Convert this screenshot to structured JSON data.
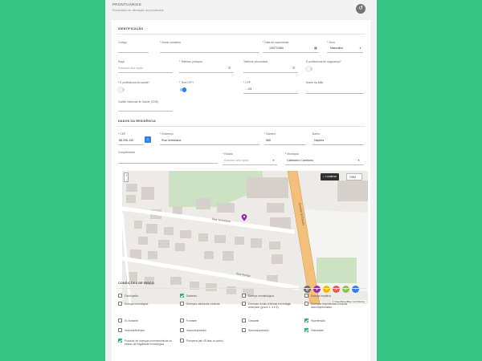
{
  "header": {
    "title": "PRONTUÁRIOS",
    "subtitle": "Formulário de alteração do prontuário"
  },
  "identificacao": {
    "section_title": "IDENTIFICAÇÃO",
    "codigo_label": "Código",
    "nome_completo_label": "* Nome completo",
    "data_nascimento_label": "* Data de nascimento",
    "data_nascimento_value": "14/07/1960",
    "sexo_label": "* Sexo",
    "sexo_value": "Masculino",
    "raca_label": "Raça",
    "raca_placeholder": "Selecione uma opção",
    "telefone_principal_label": "* Telefone principal",
    "telefone_secundario_label": "Telefone secundário",
    "profissional_seguranca_label": "É profissional de segurança?",
    "profissional_saude_label": "* É profissional da saúde?",
    "tem_cpf_label": "* Tem CPF?",
    "cpf_label": "* CPF",
    "cpf_value": "...-93",
    "nome_mae_label": "Nome da Mãe",
    "cns_label": "Cartão Nacional de Saúde (CNS)"
  },
  "residencia": {
    "section_title": "DADOS DA RESIDÊNCIA",
    "cep_label": "* CEP",
    "cep_value": "86.206-130",
    "endereco_label": "* Endereço",
    "endereco_value": "Rua Veneziana",
    "numero_label": "* Número",
    "numero_value": "560",
    "bairro_label": "Bairro",
    "bairro_value": "Nações",
    "complemento_label": "Complemento",
    "estado_label": "* Estado",
    "estado_placeholder": "Selecione uma opção",
    "municipio_label": "* Município",
    "municipio_value": "Cabeceiro Camboriú"
  },
  "map": {
    "localizar_label": "Localizar",
    "osm_label": "OSM",
    "zoom_in": "+",
    "zoom_out": "−",
    "street_1": "Rua Veneziana",
    "street_2": "Rua Rovigo",
    "street_3": "Avenida do Estado",
    "attribution": "© OpenStreetMap contributors.",
    "fab_colors": [
      "#6d6d6d",
      "#9c27b0",
      "#f7b500",
      "#ef5350",
      "#8bc34a",
      "#2f80ed"
    ]
  },
  "risco": {
    "section_title": "CONDIÇÕES DE RISCO",
    "items": [
      {
        "label": "Cardiopatia",
        "checked": false
      },
      {
        "label": "Diabetes",
        "checked": true
      },
      {
        "label": "Doença hematológica",
        "checked": false
      },
      {
        "label": "Doença hepática",
        "checked": false
      },
      {
        "label": "Doença neurológica",
        "checked": false
      },
      {
        "label": "Doenças cardíacas crônicas",
        "checked": false
      },
      {
        "label": "Doenças renais crônicas em estágio avançado (graus 3, 4 e 5)",
        "checked": false
      },
      {
        "label": "Doenças respiratórias crônicas descompensadas",
        "checked": false
      },
      {
        "label": "Ex-fumante",
        "checked": false
      },
      {
        "label": "Fumante",
        "checked": false
      },
      {
        "label": "Gestante",
        "checked": false
      },
      {
        "label": "Hipertensão",
        "checked": true
      },
      {
        "label": "Imunodeficiência",
        "checked": false
      },
      {
        "label": "Imunodepressão",
        "checked": false
      },
      {
        "label": "Neurossupressão",
        "checked": false
      },
      {
        "label": "Obesidade",
        "checked": true
      },
      {
        "label": "Portador de doenças cromossômicas ou estado de fragilidade imunológica",
        "checked": true
      },
      {
        "label": "Puérpera (até 45 dias do parto)",
        "checked": false
      }
    ]
  }
}
